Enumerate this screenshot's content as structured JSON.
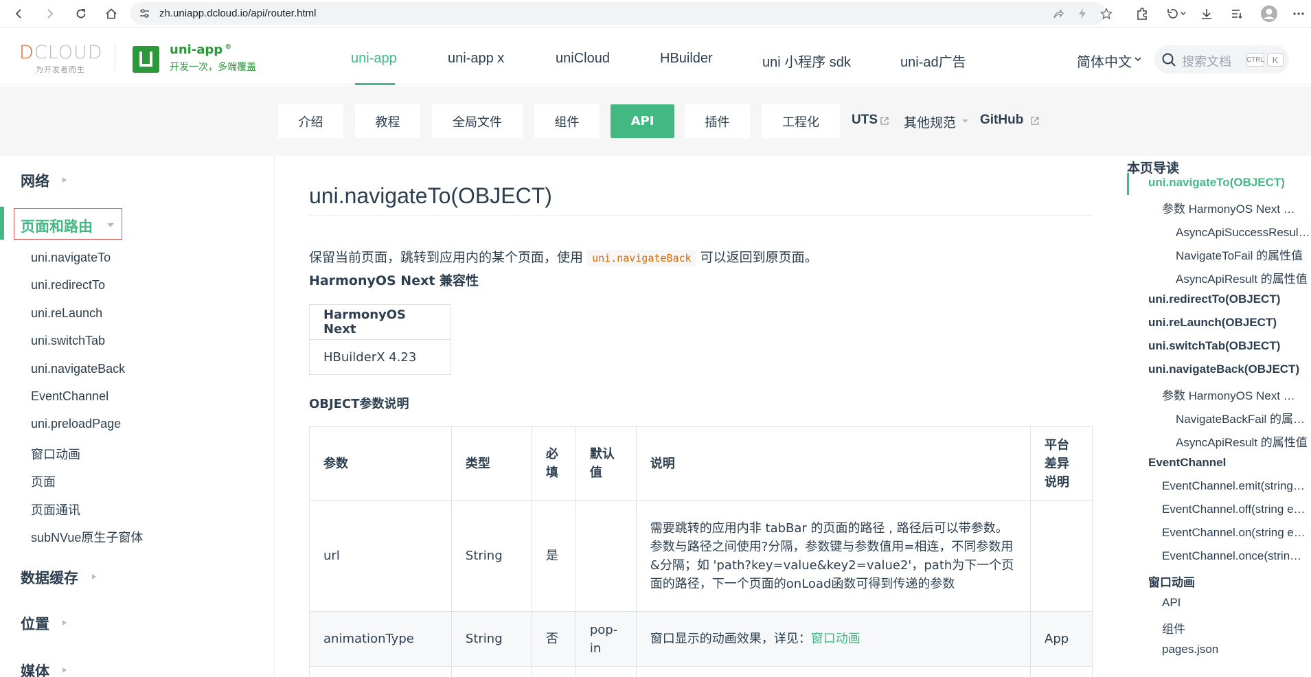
{
  "browser": {
    "url": "zh.uniapp.dcloud.io/api/router.html"
  },
  "header": {
    "dcloud_logo": "DCLOUD",
    "dcloud_tagline": "为开发者而生",
    "brand_name": "uni-app",
    "brand_mark": "®",
    "brand_slogan": "开发一次，多端覆盖",
    "nav": [
      "uni-app",
      "uni-app x",
      "uniCloud",
      "HBuilder",
      "uni 小程序 sdk",
      "uni-ad广告"
    ],
    "active_nav": "uni-app",
    "language": "简体中文",
    "search_placeholder": "搜索文档",
    "kbd_ctrl": "CTRL",
    "kbd_k": "K"
  },
  "subnav": {
    "buttons": [
      "介绍",
      "教程",
      "全局文件",
      "组件",
      "API",
      "插件",
      "工程化"
    ],
    "active": "API",
    "links": [
      "UTS",
      "其他规范",
      "GitHub"
    ]
  },
  "sidebar": {
    "groups_top": [
      "网络"
    ],
    "active_group": "页面和路由",
    "items": [
      "uni.navigateTo",
      "uni.redirectTo",
      "uni.reLaunch",
      "uni.switchTab",
      "uni.navigateBack",
      "EventChannel",
      "uni.preloadPage",
      "窗口动画",
      "页面",
      "页面通讯",
      "subNVue原生子窗体"
    ],
    "groups_bottom": [
      "数据缓存",
      "位置",
      "媒体"
    ]
  },
  "main": {
    "title": "uni.navigateTo(OBJECT)",
    "desc_before": "保留当前页面，跳转到应用内的某个页面，使用",
    "desc_code": "uni.navigateBack",
    "desc_after": "可以返回到原页面。",
    "compat_title": "HarmonyOS Next 兼容性",
    "compat_header": "HarmonyOS Next",
    "compat_value": "HBuilderX 4.23",
    "object_title": "OBJECT参数说明",
    "table_headers": [
      "参数",
      "类型",
      "必填",
      "默认值",
      "说明",
      "平台差异说明"
    ],
    "rows": [
      {
        "param": "url",
        "type": "String",
        "required": "是",
        "default": "",
        "desc": "需要跳转的应用内非 tabBar 的页面的路径 , 路径后可以带参数。参数与路径之间使用?分隔，参数键与参数值用=相连，不同参数用&分隔；如 'path?key=value&key2=value2'，path为下一个页面的路径，下一个页面的onLoad函数可得到传递的参数",
        "desc_link": "",
        "platform": ""
      },
      {
        "param": "animationType",
        "type": "String",
        "required": "否",
        "default": "pop-in",
        "desc": "窗口显示的动画效果，详见：",
        "desc_link": "窗口动画",
        "platform": "App"
      }
    ]
  },
  "toc": {
    "title": "本页导读",
    "items": [
      {
        "text": "uni.navigateTo(OBJECT)",
        "level": 1,
        "active": true
      },
      {
        "text": "参数 HarmonyOS Next 兼容性",
        "level": 2
      },
      {
        "text": "AsyncApiSuccessResult 的属性值",
        "level": 3
      },
      {
        "text": "NavigateToFail 的属性值",
        "level": 3
      },
      {
        "text": "AsyncApiResult 的属性值",
        "level": 3
      },
      {
        "text": "uni.redirectTo(OBJECT)",
        "level": 1
      },
      {
        "text": "uni.reLaunch(OBJECT)",
        "level": 1
      },
      {
        "text": "uni.switchTab(OBJECT)",
        "level": 1
      },
      {
        "text": "uni.navigateBack(OBJECT)",
        "level": 1
      },
      {
        "text": "参数 HarmonyOS Next 兼容性",
        "level": 2
      },
      {
        "text": "NavigateBackFail 的属性值",
        "level": 3
      },
      {
        "text": "AsyncApiResult 的属性值",
        "level": 3
      },
      {
        "text": "EventChannel",
        "level": 1
      },
      {
        "text": "EventChannel.emit(string eventName)",
        "level": 2
      },
      {
        "text": "EventChannel.off(string eventName)",
        "level": 2
      },
      {
        "text": "EventChannel.on(string eventName)",
        "level": 2
      },
      {
        "text": "EventChannel.once(string eventName)",
        "level": 2
      },
      {
        "text": "窗口动画",
        "level": 1
      },
      {
        "text": "API",
        "level": 2
      },
      {
        "text": "组件",
        "level": 2
      },
      {
        "text": "pages.json",
        "level": 2
      }
    ]
  },
  "colors": {
    "accent": "#42b983",
    "brand_green": "#2b9939",
    "highlight_border": "#d9534f",
    "code": "#e96900"
  },
  "icons": [
    "back-icon",
    "forward-icon",
    "reload-icon",
    "home-icon",
    "site-settings-icon",
    "share-icon",
    "lightning-icon",
    "star-icon",
    "extensions-icon",
    "history-icon",
    "download-icon",
    "collections-icon",
    "profile-icon",
    "more-icon",
    "search-icon",
    "external-link-icon",
    "chevron-down-icon",
    "chevron-right-icon"
  ]
}
